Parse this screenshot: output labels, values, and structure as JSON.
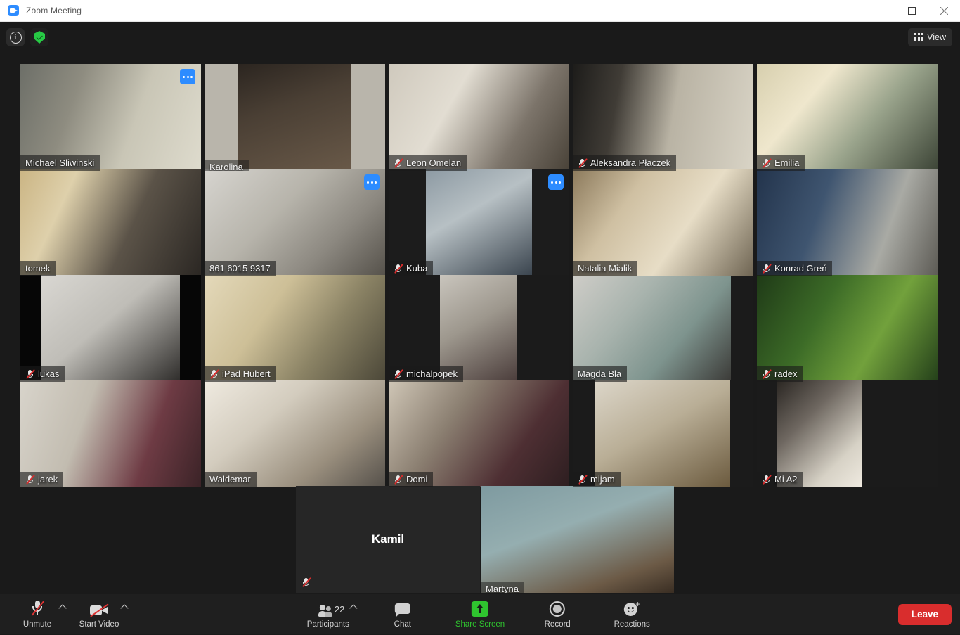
{
  "window": {
    "title": "Zoom Meeting",
    "app_icon": "zoom-camera-icon",
    "minimize": "minimize-icon",
    "maximize": "maximize-icon",
    "close": "close-icon"
  },
  "topbar": {
    "info_icon": "info-icon",
    "encryption_icon": "shield-check-icon",
    "view_label": "View",
    "view_icon": "grid-icon"
  },
  "gallery": {
    "active_speaker_color": "#d6e84a",
    "more_button_color": "#2d8cff",
    "tiles": [
      {
        "name": "Michael Sliwinski",
        "muted": false,
        "more": true,
        "active": false,
        "video": true
      },
      {
        "name": "Karolina",
        "muted": false,
        "more": false,
        "active": false,
        "video": true
      },
      {
        "name": "Leon Omelan",
        "muted": true,
        "more": false,
        "active": false,
        "video": true
      },
      {
        "name": "Aleksandra Płaczek",
        "muted": true,
        "more": false,
        "active": false,
        "video": true
      },
      {
        "name": "Emilia",
        "muted": true,
        "more": false,
        "active": false,
        "video": true
      },
      {
        "name": "tomek",
        "muted": false,
        "more": false,
        "active": false,
        "video": true
      },
      {
        "name": "861 6015 9317",
        "muted": false,
        "more": true,
        "active": false,
        "video": true
      },
      {
        "name": "Kuba",
        "muted": true,
        "more": true,
        "active": false,
        "video": true
      },
      {
        "name": "Natalia Mialik",
        "muted": false,
        "more": false,
        "active": true,
        "video": true
      },
      {
        "name": "Konrad Greń",
        "muted": true,
        "more": false,
        "active": false,
        "video": true
      },
      {
        "name": "lukas",
        "muted": true,
        "more": false,
        "active": false,
        "video": true
      },
      {
        "name": "iPad Hubert",
        "muted": true,
        "more": false,
        "active": false,
        "video": true
      },
      {
        "name": "michalpopek",
        "muted": true,
        "more": false,
        "active": false,
        "video": true
      },
      {
        "name": "Magda Bla",
        "muted": false,
        "more": false,
        "active": false,
        "video": true
      },
      {
        "name": "radex",
        "muted": true,
        "more": false,
        "active": false,
        "video": true
      },
      {
        "name": "jarek",
        "muted": true,
        "more": false,
        "active": false,
        "video": true
      },
      {
        "name": "Waldemar",
        "muted": false,
        "more": false,
        "active": false,
        "video": true
      },
      {
        "name": "Domi",
        "muted": true,
        "more": false,
        "active": false,
        "video": true
      },
      {
        "name": "mijam",
        "muted": true,
        "more": false,
        "active": false,
        "video": true
      },
      {
        "name": "Mi A2",
        "muted": true,
        "more": false,
        "active": false,
        "video": true
      },
      {
        "name": "Kamil",
        "muted": true,
        "more": false,
        "active": false,
        "video": false
      },
      {
        "name": "Martyna",
        "muted": false,
        "more": false,
        "active": false,
        "video": true
      }
    ]
  },
  "toolbar": {
    "mute_label": "Unmute",
    "mute_icon": "microphone-muted-icon",
    "video_label": "Start Video",
    "video_icon": "camera-off-icon",
    "participants_label": "Participants",
    "participants_count": "22",
    "participants_icon": "people-icon",
    "chat_label": "Chat",
    "chat_icon": "chat-bubble-icon",
    "share_label": "Share Screen",
    "share_icon": "share-arrow-icon",
    "share_color": "#2fc42f",
    "record_label": "Record",
    "record_icon": "record-circle-icon",
    "reactions_label": "Reactions",
    "reactions_icon": "smiley-plus-icon",
    "leave_label": "Leave",
    "leave_color": "#d92d2d"
  }
}
